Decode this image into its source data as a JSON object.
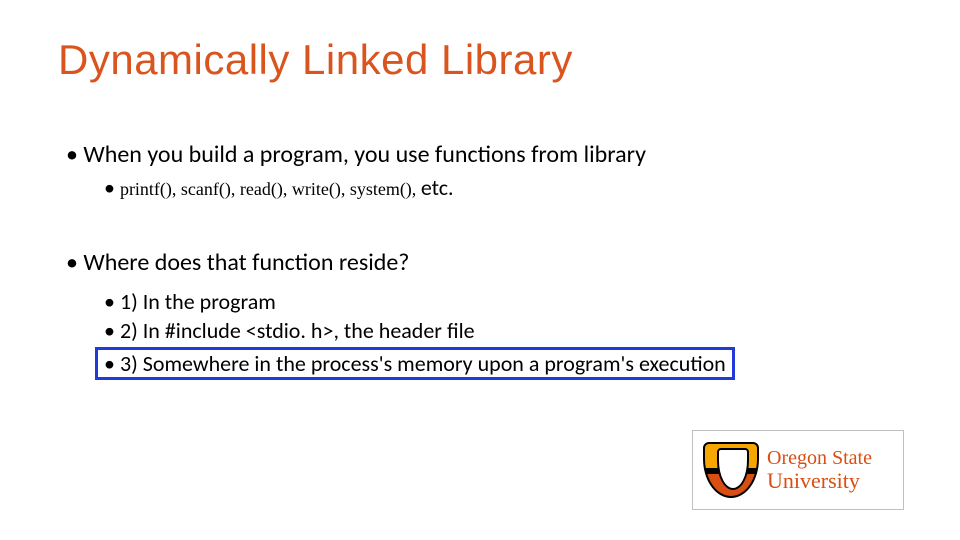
{
  "title": "Dynamically Linked Library",
  "b1": "When you build a program, you use functions from library",
  "b2_mono": "printf(), scanf(), read(), write(), system(), ",
  "b2_tail": "etc.",
  "q": "Where does that function reside?",
  "a1": "1) In the program",
  "a2": "2) In #include <stdio. h>, the header file",
  "a3": "3) Somewhere in the process's memory upon a program's execution",
  "logo_l1": "Oregon State",
  "logo_l2": "University"
}
